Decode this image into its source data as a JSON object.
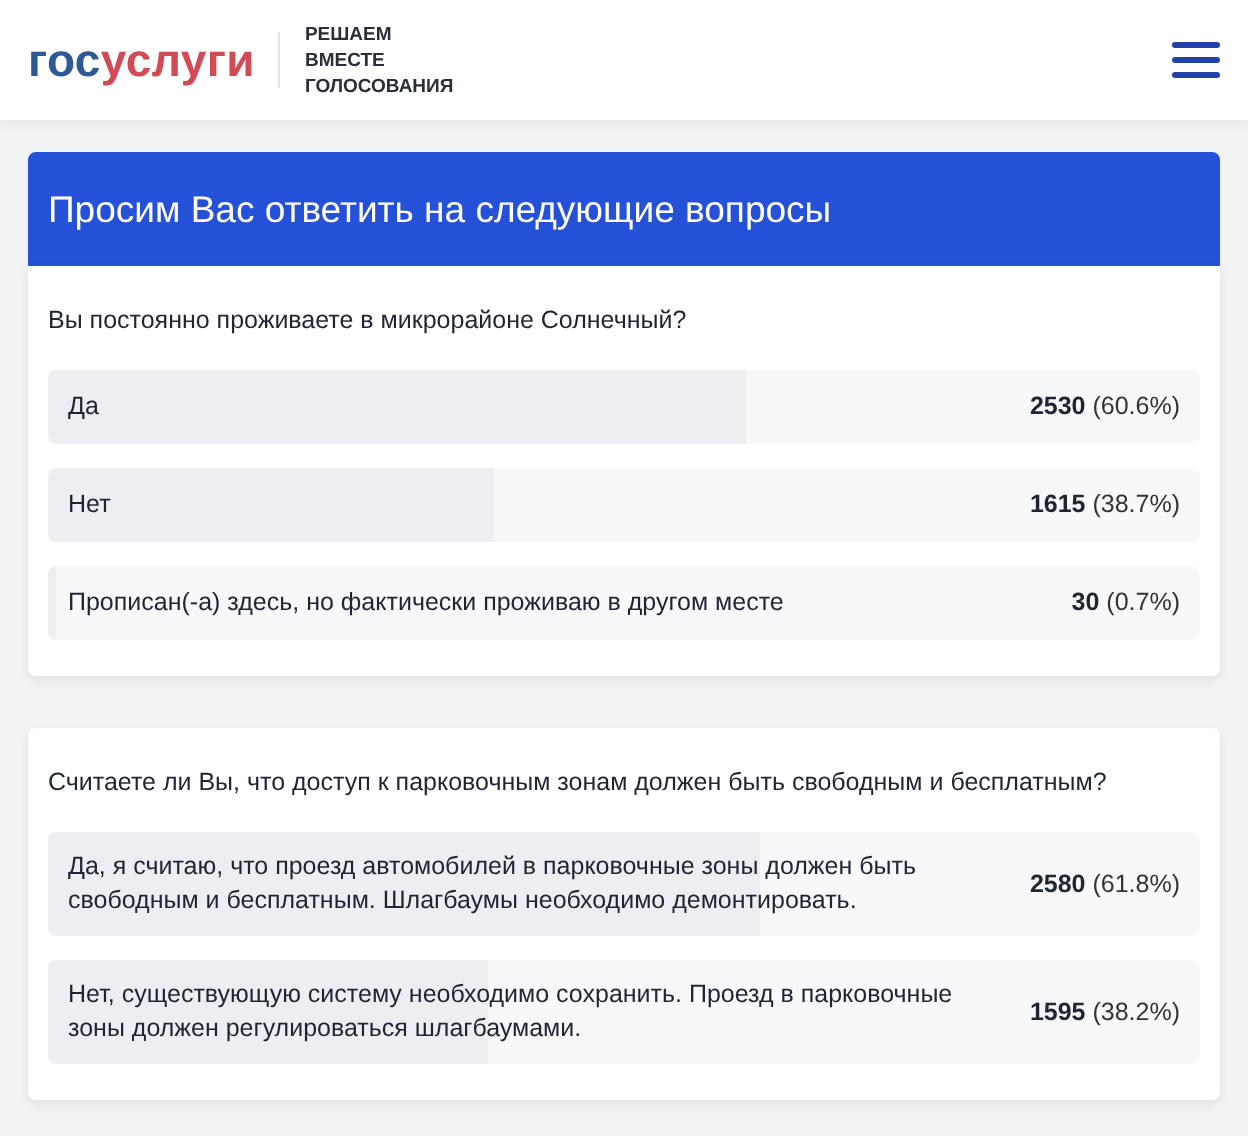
{
  "header": {
    "logo": {
      "first": "гос",
      "second": "услуги"
    },
    "tagline": "РЕШАЕМ ВМЕСТЕ ГОЛОСОВАНИЯ"
  },
  "banner": {
    "title": "Просим Вас ответить на следующие вопросы"
  },
  "questions": [
    {
      "text": "Вы постоянно проживаете в микрорайоне Солнечный?",
      "answers": [
        {
          "label": "Да",
          "result": "**2530** (60.6%)",
          "level": 0.606
        },
        {
          "label": "Нет",
          "result": "**1615** (38.7%)",
          "level": 0.387
        },
        {
          "label": "Прописан(-а) здесь, но фактически проживаю в другом месте",
          "result": "**30** (0.7%)",
          "level": 0.007
        }
      ]
    },
    {
      "text": "Считаете ли Вы, что доступ к парковочным зонам должен быть свободным и бесплатным?",
      "answers": [
        {
          "label": "Да, я считаю, что проезд автомобилей в парковочные зоны должен быть свободным и бесплатным. Шлагбаумы необходимо демонтировать.",
          "result": "**2580** (61.8%)",
          "level": 0.618
        },
        {
          "label": "Нет, существующую систему необходимо сохранить. Проезд в парковочные зоны должен регулироваться шлагбаумами.",
          "result": "**1595** (38.2%)",
          "level": 0.382
        }
      ]
    }
  ]
}
